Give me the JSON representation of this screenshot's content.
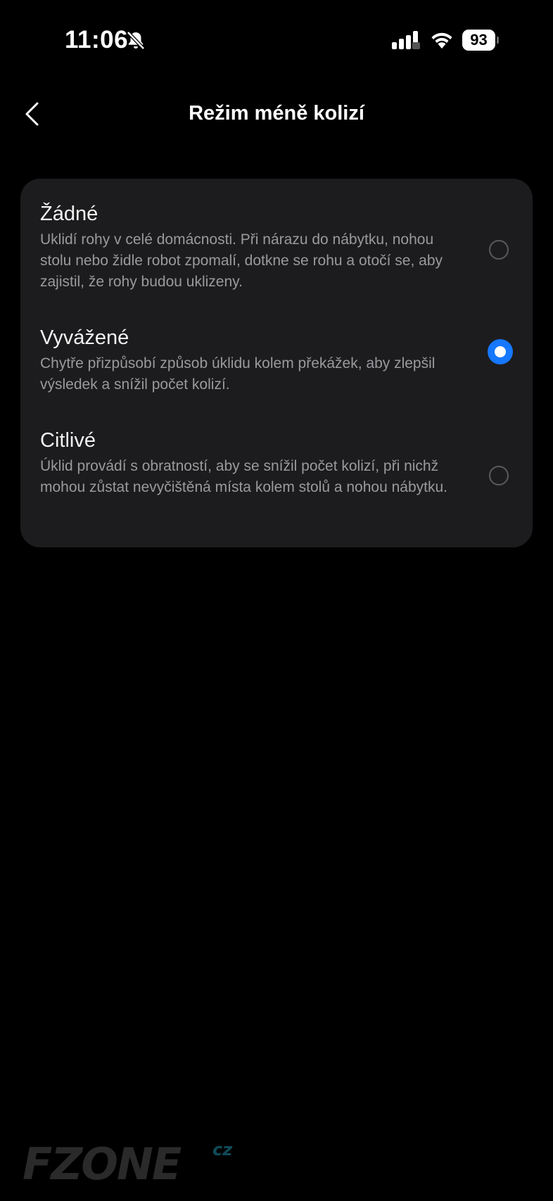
{
  "status_bar": {
    "time": "11:06",
    "battery": "93",
    "icons": [
      "bell-slash-icon",
      "cellular-signal-icon",
      "wifi-icon",
      "battery-icon"
    ]
  },
  "header": {
    "back_icon": "chevron-left-icon",
    "title": "Režim méně kolizí"
  },
  "options": [
    {
      "title": "Žádné",
      "description": "Uklidí rohy v celé domácnosti. Při nárazu do nábytku, nohou stolu nebo židle robot zpomalí, dotkne se rohu a otočí se, aby zajistil, že rohy budou uklizeny.",
      "selected": false
    },
    {
      "title": "Vyvážené",
      "description": "Chytře přizpůsobí způsob úklidu kolem překážek, aby zlepšil výsledek a snížil počet kolizí.",
      "selected": true
    },
    {
      "title": "Citlivé",
      "description": "Úklid provádí s obratností, aby se snížil počet kolizí, při nichž mohou zůstat nevyčištěná místa kolem stolů a nohou nábytku.",
      "selected": false
    }
  ],
  "colors": {
    "background": "#000000",
    "card": "#1c1c1e",
    "accent": "#1677ff",
    "secondary_text": "#9a9a9e"
  },
  "watermark": {
    "brand": "FZONE",
    "suffix": "cz"
  }
}
